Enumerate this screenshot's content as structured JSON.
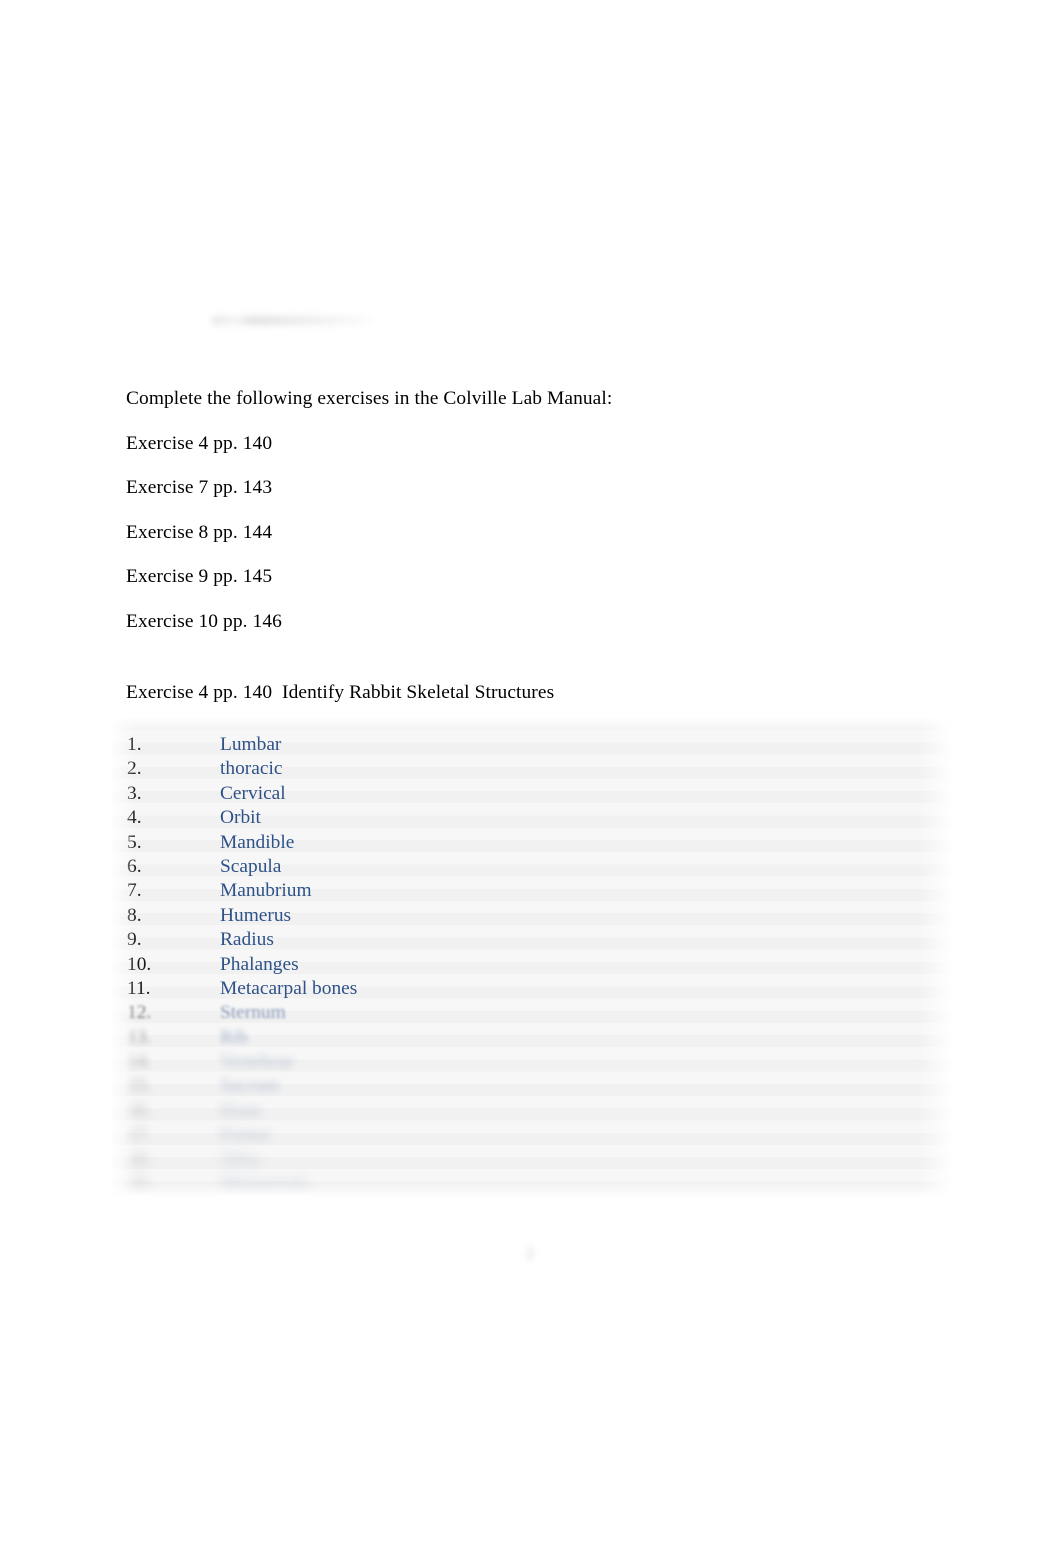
{
  "document": {
    "intro": "Complete the following exercises in the Colville Lab Manual:",
    "exercise_refs": [
      "Exercise 4 pp. 140",
      "Exercise 7 pp. 143",
      "Exercise 8 pp. 144",
      "Exercise 9 pp. 145",
      "Exercise 10 pp. 146"
    ],
    "section_heading": "Exercise 4 pp. 140  Identify Rabbit Skeletal Structures",
    "page_number": "2"
  },
  "answer_list": {
    "rows": [
      {
        "num": "1.",
        "value": "Lumbar",
        "state": "visible"
      },
      {
        "num": "2.",
        "value": "thoracic",
        "state": "visible"
      },
      {
        "num": "3.",
        "value": "Cervical",
        "state": "visible"
      },
      {
        "num": "4.",
        "value": "Orbit",
        "state": "visible"
      },
      {
        "num": "5.",
        "value": "Mandible",
        "state": "visible"
      },
      {
        "num": "6.",
        "value": "Scapula",
        "state": "visible"
      },
      {
        "num": "7.",
        "value": "Manubrium",
        "state": "visible"
      },
      {
        "num": "8.",
        "value": "Humerus",
        "state": "visible"
      },
      {
        "num": "9.",
        "value": "Radius",
        "state": "visible"
      },
      {
        "num": "10.",
        "value": "Phalanges",
        "state": "visible"
      },
      {
        "num": "11.",
        "value": "Metacarpal bones",
        "state": "visible"
      },
      {
        "num": "12.",
        "value": "Sternum",
        "state": "obscured-1"
      },
      {
        "num": "13.",
        "value": "Rib",
        "state": "obscured-2"
      },
      {
        "num": "14.",
        "value": "Vertebrae",
        "state": "obscured-3"
      },
      {
        "num": "15.",
        "value": "Sacrum",
        "state": "obscured-3"
      },
      {
        "num": "16.",
        "value": "Ilium",
        "state": "obscured-4"
      },
      {
        "num": "17.",
        "value": "Femur",
        "state": "obscured-4"
      },
      {
        "num": "18.",
        "value": "Tibia",
        "state": "obscured-5"
      },
      {
        "num": "19.",
        "value": "Metatarsals",
        "state": "obscured-5"
      }
    ]
  },
  "colors": {
    "answer_text": "#2e5288",
    "body_text": "#000000",
    "panel_background": "#f4f4f4"
  }
}
